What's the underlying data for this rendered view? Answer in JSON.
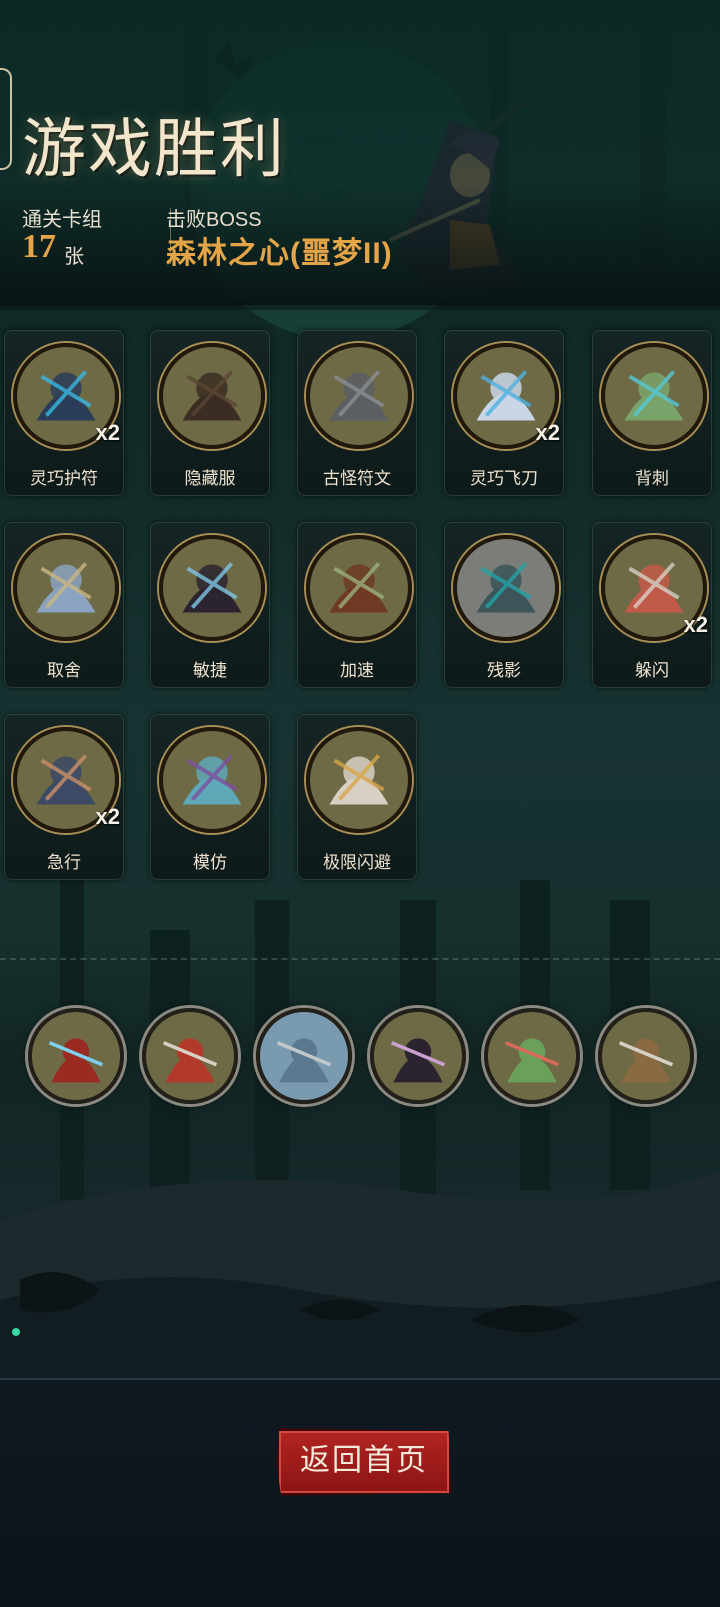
{
  "header": {
    "title": "游戏胜利",
    "deck_label": "通关卡组",
    "deck_count": "17",
    "deck_unit": "张",
    "boss_label": "击败BOSS",
    "boss_name": "森林之心(噩梦II)"
  },
  "cards": [
    {
      "name": "灵巧护符",
      "count": "x2",
      "icon": "crossbow-amulet-icon"
    },
    {
      "name": "隐藏服",
      "count": "",
      "icon": "hooded-cloak-icon"
    },
    {
      "name": "古怪符文",
      "count": "",
      "icon": "rune-stone-icon"
    },
    {
      "name": "灵巧飞刀",
      "count": "x2",
      "icon": "flying-daggers-icon"
    },
    {
      "name": "背刺",
      "count": "",
      "icon": "backstab-icon"
    },
    {
      "name": "取舍",
      "count": "",
      "icon": "old-sage-icon"
    },
    {
      "name": "敏捷",
      "count": "",
      "icon": "black-cat-icon"
    },
    {
      "name": "加速",
      "count": "",
      "icon": "witch-broom-icon"
    },
    {
      "name": "残影",
      "count": "",
      "icon": "afterimage-icon"
    },
    {
      "name": "躲闪",
      "count": "x2",
      "icon": "dodge-icon"
    },
    {
      "name": "急行",
      "count": "x2",
      "icon": "dwarf-dash-icon"
    },
    {
      "name": "模仿",
      "count": "",
      "icon": "goblin-face-icon"
    },
    {
      "name": "极限闪避",
      "count": "",
      "icon": "extreme-dodge-icon"
    }
  ],
  "relics": [
    {
      "icon": "hooded-mage-icon"
    },
    {
      "icon": "red-hood-girl-icon"
    },
    {
      "icon": "dagger-icon"
    },
    {
      "icon": "vampire-icon"
    },
    {
      "icon": "dryad-icon"
    },
    {
      "icon": "rogue-slash-icon"
    }
  ],
  "footer": {
    "return_label": "返回首页"
  },
  "colors": {
    "accent_gold": "#e3a548",
    "button_red": "#a51e1c",
    "card_bg": "#121f1f"
  }
}
